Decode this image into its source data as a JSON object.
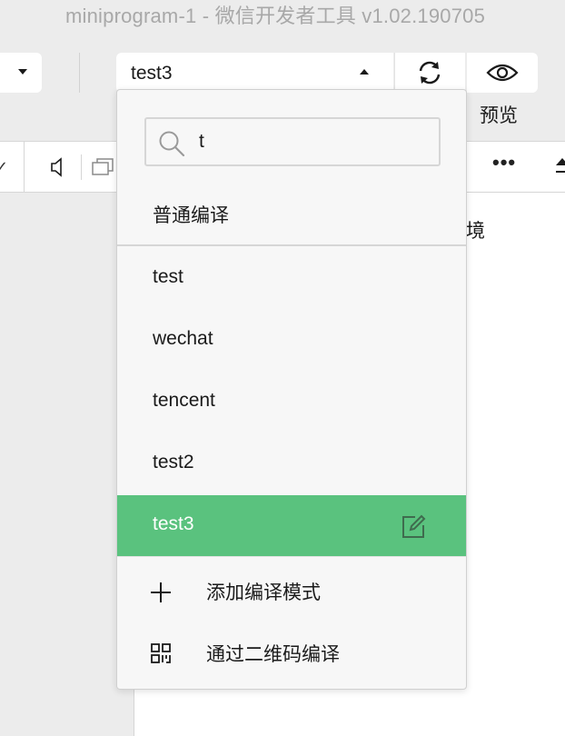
{
  "window": {
    "title": "miniprogram-1 - 微信开发者工具 v1.02.190705"
  },
  "toolbar": {
    "compile_mode_value": "test3",
    "preview_label": "预览"
  },
  "content": {
    "partial_text": "境"
  },
  "compile_dropdown": {
    "search": {
      "value": "t",
      "placeholder": ""
    },
    "normal_compile_label": "普通编译",
    "modes": [
      {
        "label": "test",
        "selected": false
      },
      {
        "label": "wechat",
        "selected": false
      },
      {
        "label": "tencent",
        "selected": false
      },
      {
        "label": "test2",
        "selected": false
      },
      {
        "label": "test3",
        "selected": true
      }
    ],
    "actions": {
      "add_mode_label": "添加编译模式",
      "qr_compile_label": "通过二维码编译"
    }
  },
  "colors": {
    "selected_bg": "#5ac27e",
    "panel_bg": "#ececec",
    "dropdown_bg": "#f7f7f7"
  },
  "icons": [
    "caret-down-icon",
    "caret-up-icon",
    "refresh-icon",
    "eye-icon",
    "search-icon",
    "edit-icon",
    "plus-icon",
    "qrcode-icon",
    "speaker-icon",
    "rotate-icon",
    "more-icon"
  ]
}
